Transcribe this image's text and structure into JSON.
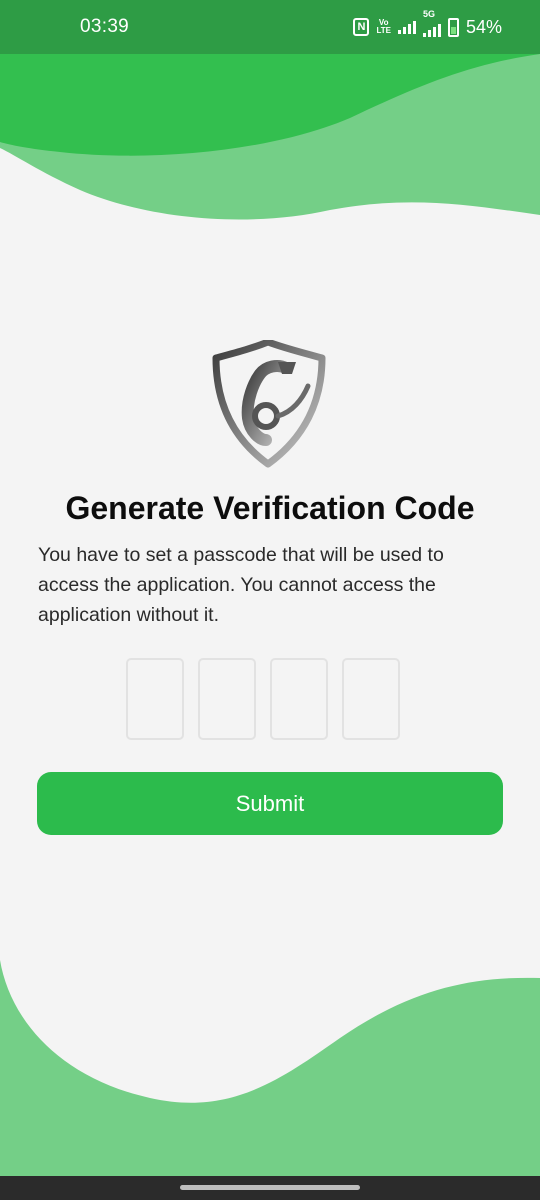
{
  "status_bar": {
    "time": "03:39",
    "nfc_label": "N",
    "volte_top": "Vo",
    "volte_bottom": "LTE",
    "network_label": "5G",
    "battery_percent": "54%"
  },
  "logo": {
    "icon": "shield-wrench-icon"
  },
  "title": "Generate Verification Code",
  "description": "You have to set a passcode that will be used to access the application. You cannot access the application without it.",
  "code_inputs": [
    {
      "value": ""
    },
    {
      "value": ""
    },
    {
      "value": ""
    },
    {
      "value": ""
    }
  ],
  "submit_label": "Submit",
  "colors": {
    "status_bar": "#2e9c45",
    "wave_dark": "#33bf4f",
    "wave_light": "#74cf87",
    "button": "#2cbb4c",
    "background": "#f4f4f4"
  }
}
